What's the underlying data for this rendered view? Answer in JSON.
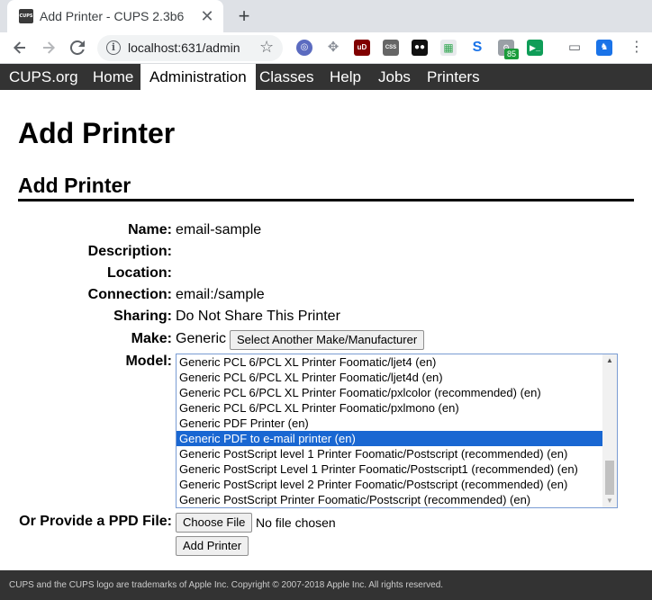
{
  "browser": {
    "tab_title": "Add Printer - CUPS 2.3b6",
    "tab_favicon_text": "CUPS",
    "tab_close": "✕",
    "new_tab": "+",
    "url": "localhost:631/admin",
    "extension_badge": "85"
  },
  "nav": {
    "items": [
      "CUPS.org",
      "Home",
      "Administration",
      "Classes",
      "Help",
      "Jobs",
      "Printers"
    ],
    "active": "Administration"
  },
  "page": {
    "title": "Add Printer",
    "section_title": "Add Printer"
  },
  "form": {
    "name_label": "Name:",
    "name_value": "email-sample",
    "description_label": "Description:",
    "description_value": "",
    "location_label": "Location:",
    "location_value": "",
    "connection_label": "Connection:",
    "connection_value": "email:/sample",
    "sharing_label": "Sharing:",
    "sharing_value": "Do Not Share This Printer",
    "make_label": "Make:",
    "make_value": "Generic",
    "make_button": "Select Another Make/Manufacturer",
    "model_label": "Model:",
    "model_options": [
      "Generic PCL 6/PCL XL Printer Foomatic/ljet4 (en)",
      "Generic PCL 6/PCL XL Printer Foomatic/ljet4d (en)",
      "Generic PCL 6/PCL XL Printer Foomatic/pxlcolor (recommended) (en)",
      "Generic PCL 6/PCL XL Printer Foomatic/pxlmono (en)",
      "Generic PDF Printer (en)",
      "Generic PDF to e-mail printer (en)",
      "Generic PostScript level 1 Printer Foomatic/Postscript (recommended) (en)",
      "Generic PostScript Level 1 Printer Foomatic/Postscript1 (recommended) (en)",
      "Generic PostScript level 2 Printer Foomatic/Postscript (recommended) (en)",
      "Generic PostScript Printer Foomatic/Postscript (recommended) (en)"
    ],
    "model_selected_index": 5,
    "ppd_label": "Or Provide a PPD File:",
    "choose_file_button": "Choose File",
    "no_file_text": "No file chosen",
    "submit_button": "Add Printer"
  },
  "footer": {
    "text": "CUPS and the CUPS logo are trademarks of Apple Inc. Copyright © 2007-2018 Apple Inc. All rights reserved."
  },
  "colors": {
    "nav_bg": "#333333",
    "selection": "#1967d2",
    "listbox_border": "#7a9cd3"
  }
}
